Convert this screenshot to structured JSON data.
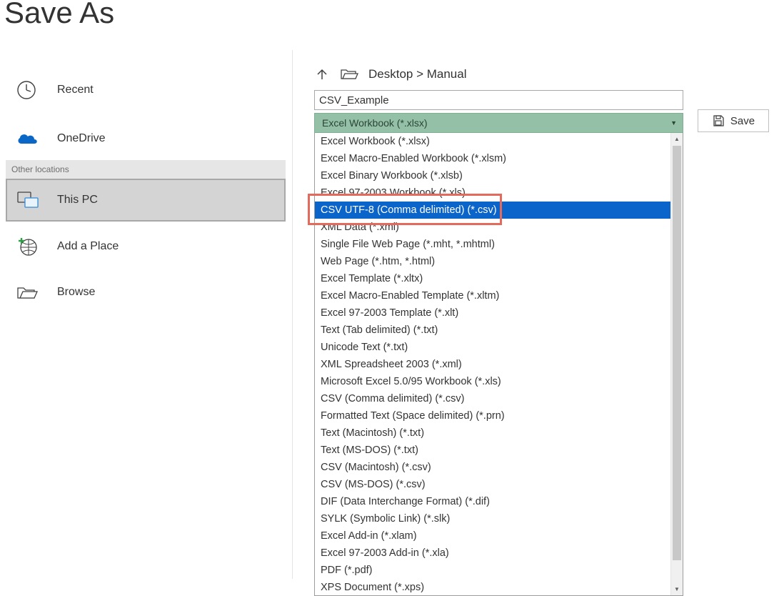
{
  "title": "Save As",
  "sidebar": {
    "recent": "Recent",
    "onedrive": "OneDrive",
    "other_header": "Other locations",
    "this_pc": "This PC",
    "add_place": "Add a Place",
    "browse": "Browse"
  },
  "breadcrumb": {
    "path": "Desktop > Manual"
  },
  "filename": "CSV_Example",
  "type_selected": "Excel Workbook (*.xlsx)",
  "save_label": "Save",
  "dropdown_items": [
    "Excel Workbook (*.xlsx)",
    "Excel Macro-Enabled Workbook (*.xlsm)",
    "Excel Binary Workbook (*.xlsb)",
    "Excel 97-2003 Workbook (*.xls)",
    "CSV UTF-8 (Comma delimited) (*.csv)",
    "XML Data (*.xml)",
    "Single File Web Page (*.mht, *.mhtml)",
    "Web Page (*.htm, *.html)",
    "Excel Template (*.xltx)",
    "Excel Macro-Enabled Template (*.xltm)",
    "Excel 97-2003 Template (*.xlt)",
    "Text (Tab delimited) (*.txt)",
    "Unicode Text (*.txt)",
    "XML Spreadsheet 2003 (*.xml)",
    "Microsoft Excel 5.0/95 Workbook (*.xls)",
    "CSV (Comma delimited) (*.csv)",
    "Formatted Text (Space delimited) (*.prn)",
    "Text (Macintosh) (*.txt)",
    "Text (MS-DOS) (*.txt)",
    "CSV (Macintosh) (*.csv)",
    "CSV (MS-DOS) (*.csv)",
    "DIF (Data Interchange Format) (*.dif)",
    "SYLK (Symbolic Link) (*.slk)",
    "Excel Add-in (*.xlam)",
    "Excel 97-2003 Add-in (*.xla)",
    "PDF (*.pdf)",
    "XPS Document (*.xps)"
  ],
  "dropdown_highlight_index": 4
}
